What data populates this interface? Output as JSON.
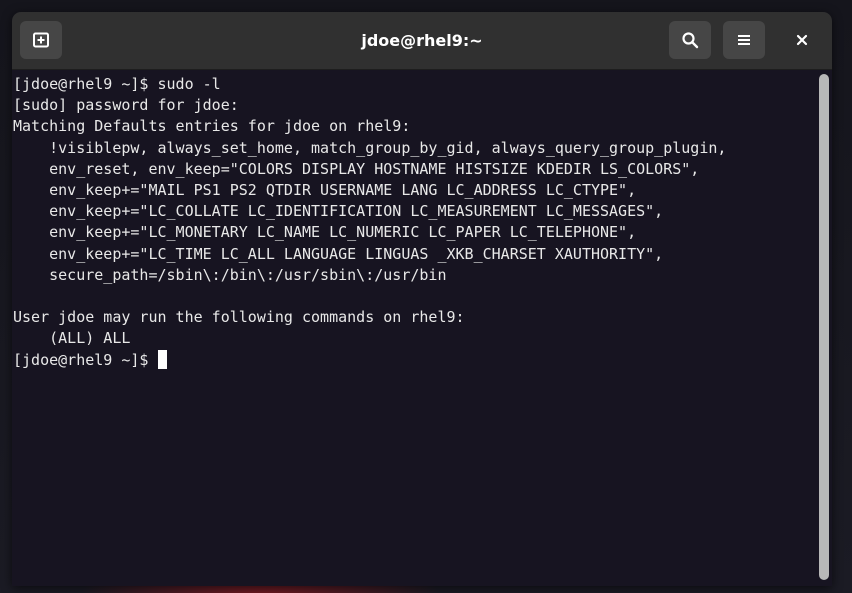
{
  "window": {
    "title": "jdoe@rhel9:~"
  },
  "headerbar": {
    "new_tab_icon": "new-tab-icon",
    "search_icon": "search-icon",
    "menu_icon": "hamburger-menu-icon",
    "close_label": "×"
  },
  "terminal": {
    "lines": [
      "[jdoe@rhel9 ~]$ sudo -l",
      "[sudo] password for jdoe:",
      "Matching Defaults entries for jdoe on rhel9:",
      "    !visiblepw, always_set_home, match_group_by_gid, always_query_group_plugin,",
      "    env_reset, env_keep=\"COLORS DISPLAY HOSTNAME HISTSIZE KDEDIR LS_COLORS\",",
      "    env_keep+=\"MAIL PS1 PS2 QTDIR USERNAME LANG LC_ADDRESS LC_CTYPE\",",
      "    env_keep+=\"LC_COLLATE LC_IDENTIFICATION LC_MEASUREMENT LC_MESSAGES\",",
      "    env_keep+=\"LC_MONETARY LC_NAME LC_NUMERIC LC_PAPER LC_TELEPHONE\",",
      "    env_keep+=\"LC_TIME LC_ALL LANGUAGE LINGUAS _XKB_CHARSET XAUTHORITY\",",
      "    secure_path=/sbin\\:/bin\\:/usr/sbin\\:/usr/bin",
      "",
      "User jdoe may run the following commands on rhel9:",
      "    (ALL) ALL"
    ],
    "prompt": "[jdoe@rhel9 ~]$ "
  },
  "colors": {
    "terminal_bg": "#171421",
    "headerbar_bg": "#303030",
    "text": "#e8e8e8"
  }
}
